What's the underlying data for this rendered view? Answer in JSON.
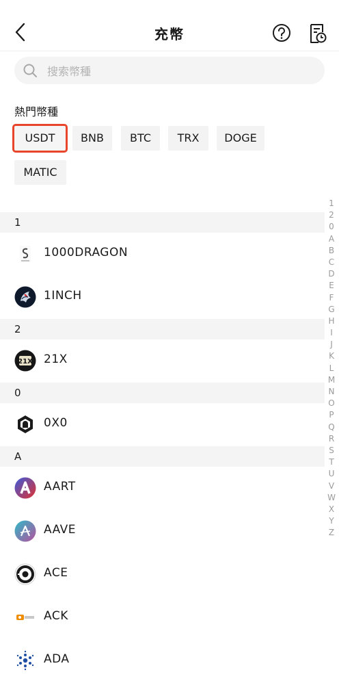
{
  "header": {
    "title": "充幣"
  },
  "search": {
    "placeholder": "搜索幣種"
  },
  "hot": {
    "title": "熱門幣種",
    "chips": [
      "USDT",
      "BNB",
      "BTC",
      "TRX",
      "DOGE",
      "MATIC"
    ],
    "selected": "USDT"
  },
  "sections": [
    {
      "letter": "1",
      "coins": [
        "1000DRAGON",
        "1INCH"
      ]
    },
    {
      "letter": "2",
      "coins": [
        "21X"
      ]
    },
    {
      "letter": "0",
      "coins": [
        "0X0"
      ]
    },
    {
      "letter": "A",
      "coins": [
        "AART",
        "AAVE",
        "ACE",
        "ACK",
        "ADA"
      ]
    }
  ],
  "index_letters": [
    "1",
    "2",
    "0",
    "A",
    "B",
    "C",
    "D",
    "E",
    "F",
    "G",
    "H",
    "I",
    "J",
    "K",
    "L",
    "M",
    "N",
    "O",
    "P",
    "Q",
    "R",
    "S",
    "T",
    "U",
    "V",
    "W",
    "X",
    "Y",
    "Z"
  ],
  "colors": {
    "selected_outline": "#e8452b",
    "chip_bg": "#f3f3f3",
    "section_bg": "#f4f4f4"
  }
}
